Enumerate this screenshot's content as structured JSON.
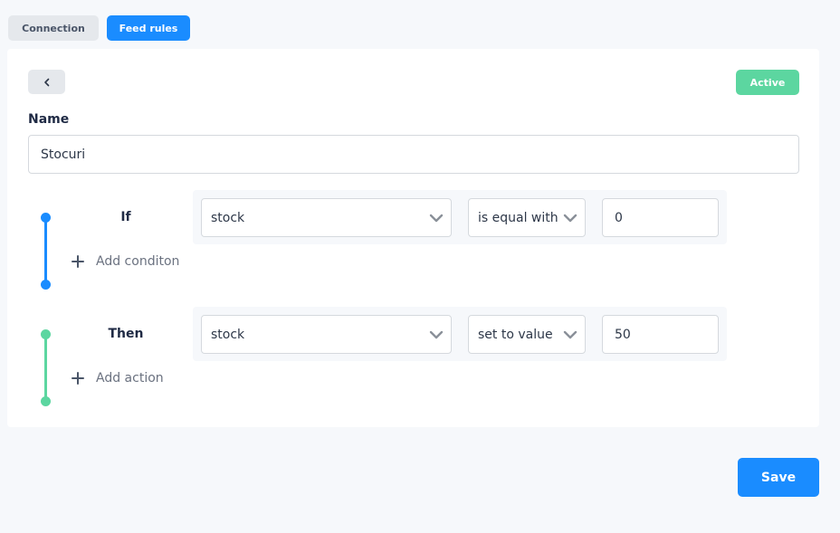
{
  "tabs": {
    "connection_label": "Connection",
    "feed_rules_label": "Feed rules",
    "active_tab": "Feed rules"
  },
  "header": {
    "back_icon": "chevron-left-icon",
    "status": "Active"
  },
  "form": {
    "name_label": "Name",
    "name_value": "Stocuri"
  },
  "condition": {
    "label": "If",
    "field": "stock",
    "operator": "is equal with",
    "value": "0",
    "add_label": "Add conditon"
  },
  "action": {
    "label": "Then",
    "field": "stock",
    "operator": "set to value",
    "value": "50",
    "add_label": "Add action"
  },
  "footer": {
    "save_label": "Save"
  },
  "colors": {
    "primary": "#1a8cff",
    "success": "#5cd6a0",
    "condition_timeline": "#1a8cff",
    "action_timeline": "#5cd6a0"
  }
}
